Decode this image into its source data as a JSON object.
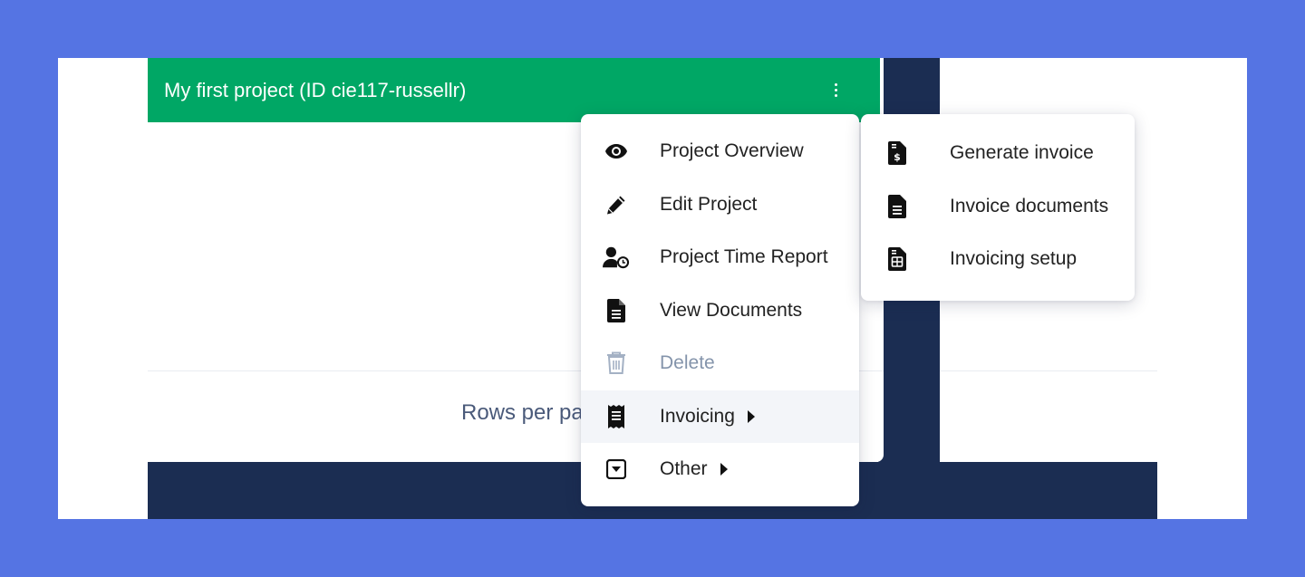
{
  "project": {
    "title": "My first project (ID cie117-russellr)"
  },
  "pagination": {
    "rows_per_page_label": "Rows per pa"
  },
  "context_menu": {
    "items": [
      {
        "label": "Project Overview",
        "icon": "eye-icon"
      },
      {
        "label": "Edit Project",
        "icon": "pencil-icon"
      },
      {
        "label": "Project Time Report",
        "icon": "user-clock-icon"
      },
      {
        "label": "View Documents",
        "icon": "file-lines-icon"
      },
      {
        "label": "Delete",
        "icon": "trash-icon",
        "disabled": true
      },
      {
        "label": "Invoicing",
        "icon": "receipt-icon",
        "has_submenu": true,
        "highlighted": true
      },
      {
        "label": "Other",
        "icon": "square-caret-down-icon",
        "has_submenu": true
      }
    ]
  },
  "invoicing_submenu": {
    "items": [
      {
        "label": "Generate invoice",
        "icon": "file-invoice-dollar-icon"
      },
      {
        "label": "Invoice documents",
        "icon": "file-lines-icon"
      },
      {
        "label": "Invoicing setup",
        "icon": "file-setup-icon"
      }
    ]
  },
  "colors": {
    "page_background": "#5574e3",
    "header_green": "#00a765",
    "navy": "#1b2d52",
    "disabled_text": "#8494ab",
    "hover_background": "#f3f5f9"
  }
}
